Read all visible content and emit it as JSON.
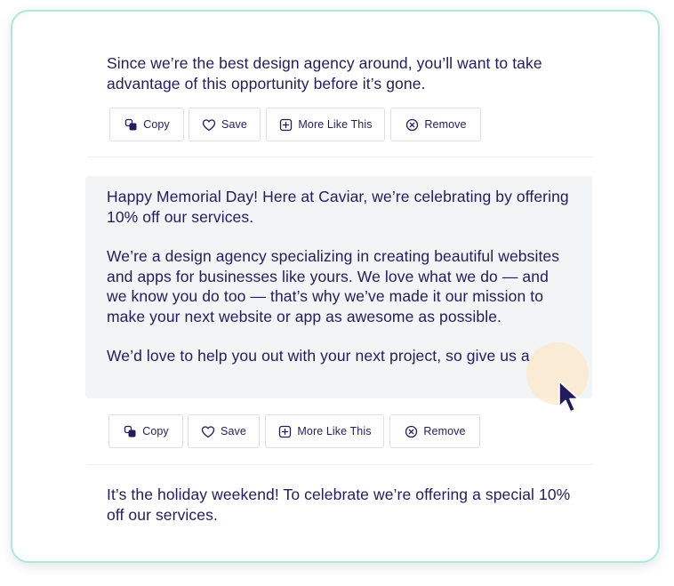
{
  "results": [
    {
      "paragraphs": [
        "Since we’re the best design agency around, you’ll want to take advantage of this opportunity before it’s gone."
      ]
    },
    {
      "paragraphs": [
        "Happy Memorial Day! Here at Caviar, we’re celebrating by offering 10% off our services.",
        "We’re a design agency specializing in creating beautiful websites and apps for businesses like yours. We love what we do — and we know you do too — that’s why we’ve made it our mission to make your next website or app as awesome as possible.",
        "We’d love to help you out with your next project, so give us a"
      ]
    },
    {
      "paragraphs": [
        "It’s the holiday weekend! To celebrate we’re offering a special 10% off our services."
      ]
    }
  ],
  "actions": {
    "copy": "Copy",
    "save": "Save",
    "more_like_this": "More Like This",
    "remove": "Remove"
  },
  "icons": {
    "copy": "copy-icon",
    "save": "heart-icon",
    "more_like_this": "plus-box-icon",
    "remove": "close-circle-icon",
    "cursor": "mouse-pointer-icon"
  },
  "colors": {
    "text": "#231c5c",
    "card_border": "#a9ead8",
    "highlight_bg": "#f3f4f6",
    "cursor_halo": "#fce8c8"
  }
}
